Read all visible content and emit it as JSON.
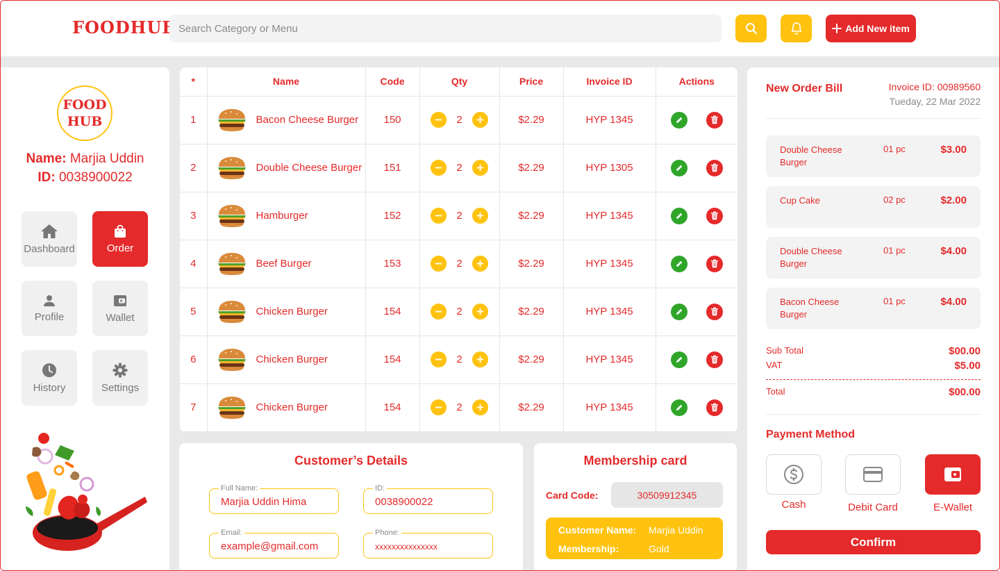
{
  "header": {
    "logo": "FOODHUB",
    "search_placeholder": "Search Category or Menu",
    "add_button_label": "Add New item"
  },
  "sidebar": {
    "avatar_line1": "FOOD",
    "avatar_line2": "HUB",
    "name_key": "Name:",
    "name_value": "Marjia Uddin",
    "id_key": "ID:",
    "id_value": "0038900022",
    "nav": [
      {
        "label": "Dashboard",
        "icon": "home-icon"
      },
      {
        "label": "Order",
        "icon": "shopping-bag-icon",
        "active": true
      },
      {
        "label": "Profile",
        "icon": "user-icon"
      },
      {
        "label": "Wallet",
        "icon": "wallet-icon"
      },
      {
        "label": "History",
        "icon": "clock-icon"
      },
      {
        "label": "Settings",
        "icon": "gear-icon"
      }
    ]
  },
  "orders": {
    "columns": [
      "*",
      "Name",
      "Code",
      "Qty",
      "Price",
      "Invoice ID",
      "Actions"
    ],
    "rows": [
      {
        "no": "1",
        "name": "Bacon Cheese Burger",
        "code": "150",
        "qty": "2",
        "price": "$2.29",
        "invoice": "HYP 1345"
      },
      {
        "no": "2",
        "name": "Double Cheese Burger",
        "code": "151",
        "qty": "2",
        "price": "$2.29",
        "invoice": "HYP 1305"
      },
      {
        "no": "3",
        "name": "Hamburger",
        "code": "152",
        "qty": "2",
        "price": "$2.29",
        "invoice": "HYP 1345"
      },
      {
        "no": "4",
        "name": "Beef Burger",
        "code": "153",
        "qty": "2",
        "price": "$2.29",
        "invoice": "HYP 1345"
      },
      {
        "no": "5",
        "name": "Chicken Burger",
        "code": "154",
        "qty": "2",
        "price": "$2.29",
        "invoice": "HYP 1345"
      },
      {
        "no": "6",
        "name": "Chicken Burger",
        "code": "154",
        "qty": "2",
        "price": "$2.29",
        "invoice": "HYP 1345"
      },
      {
        "no": "7",
        "name": "Chicken Burger",
        "code": "154",
        "qty": "2",
        "price": "$2.29",
        "invoice": "HYP 1345"
      }
    ]
  },
  "customer": {
    "title": "Customer’s Details",
    "full_name_label": "Full Name:",
    "full_name": "Marjia Uddin Hima",
    "id_label": "ID:",
    "id": "0038900022",
    "email_label": "Email:",
    "email": "example@gmail.com",
    "phone_label": "Phone:",
    "phone": "xxxxxxxxxxxxxxx"
  },
  "membership": {
    "title": "Membership card",
    "card_code_label": "Card Code:",
    "card_code": "30509912345",
    "customer_name_label": "Customer Name:",
    "customer_name": "Marjia Uddin",
    "membership_label": "Membership:",
    "membership": "Gold"
  },
  "bill": {
    "title": "New Order Bill",
    "invoice": "Invoice ID: 00989560",
    "date": "Tueday, 22 Mar 2022",
    "items": [
      {
        "name": "Double Cheese Burger",
        "qty": "01 pc",
        "price": "$3.00"
      },
      {
        "name": "Cup Cake",
        "qty": "02 pc",
        "price": "$2.00"
      },
      {
        "name": "Double Cheese Burger",
        "qty": "01 pc",
        "price": "$4.00"
      },
      {
        "name": "Bacon Cheese Burger",
        "qty": "01 pc",
        "price": "$4.00"
      }
    ],
    "subtotal_label": "Sub Total",
    "subtotal": "$00.00",
    "vat_label": "VAT",
    "vat": "$5.00",
    "total_label": "Total",
    "total": "$00.00",
    "payment_title": "Payment Method",
    "payments": [
      {
        "label": "Cash",
        "icon": "dollar-icon"
      },
      {
        "label": "Debit Card",
        "icon": "credit-card-icon"
      },
      {
        "label": "E-Wallet",
        "icon": "wallet-icon",
        "active": true
      }
    ],
    "confirm_label": "Confirm"
  },
  "colors": {
    "primary": "#e42a2a",
    "accent": "#ffc20e",
    "background": "#e9e9e9"
  }
}
